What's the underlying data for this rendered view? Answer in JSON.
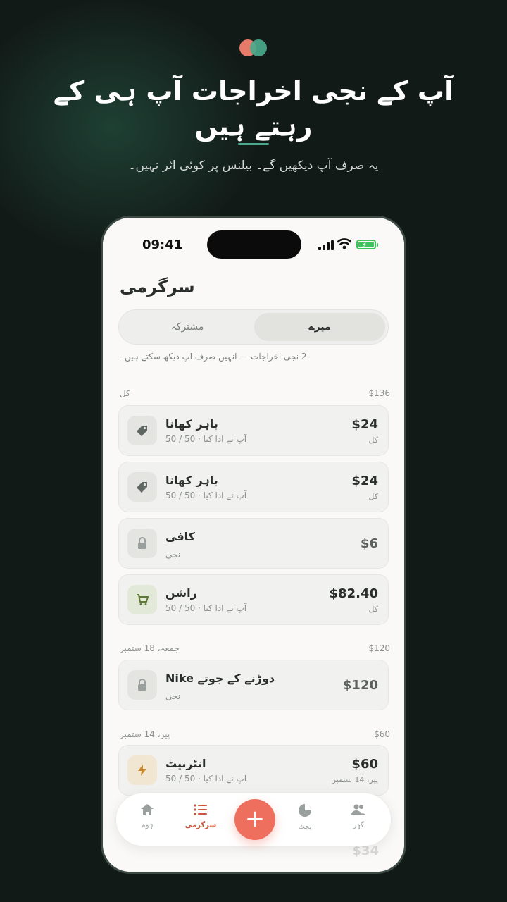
{
  "promo": {
    "headline": "آپ کے نجی اخراجات آپ ہی کے رہتے ہیں",
    "subline": "یہ صرف آپ دیکھیں گے۔ بیلنس پر کوئی اثر نہیں۔"
  },
  "status_bar": {
    "time": "09:41"
  },
  "screen": {
    "title": "سرگرمی",
    "segments": {
      "mine": "میرے",
      "shared": "مشترکہ",
      "active": "mine"
    },
    "note": "2 نجی اخراجات — انہیں صرف آپ دیکھ سکتے ہیں۔"
  },
  "groups": [
    {
      "label": "کل",
      "total": "$136",
      "items": [
        {
          "title": "باہر کھانا",
          "sub": "آپ نے ادا کیا · 50 / 50",
          "amount": "$24",
          "tag": "کل",
          "icon": "tag-icon"
        },
        {
          "title": "باہر کھانا",
          "sub": "آپ نے ادا کیا · 50 / 50",
          "amount": "$24",
          "tag": "کل",
          "icon": "tag-icon"
        },
        {
          "title": "کافی",
          "sub": "نجی",
          "amount": "$6",
          "tag": "",
          "icon": "lock-icon"
        },
        {
          "title": "راشن",
          "sub": "آپ نے ادا کیا · 50 / 50",
          "amount": "$82.40",
          "tag": "کل",
          "icon": "cart-icon"
        }
      ]
    },
    {
      "label": "جمعہ، 18 ستمبر",
      "total": "$120",
      "items": [
        {
          "title": "دوڑنے کے جوتے Nike",
          "sub": "نجی",
          "amount": "$120",
          "tag": "",
          "icon": "lock-icon"
        }
      ]
    },
    {
      "label": "پیر، 14 ستمبر",
      "total": "$60",
      "items": [
        {
          "title": "انٹرنیٹ",
          "sub": "آپ نے ادا کیا · 50 / 50",
          "amount": "$60",
          "tag": "پیر، 14 ستمبر",
          "icon": "bolt-icon"
        }
      ]
    }
  ],
  "ghost_amount": "$34",
  "tabbar": {
    "home": "ہوم",
    "activity": "سرگرمی",
    "add": "+",
    "budget": "بجٹ",
    "household": "گھر"
  },
  "colors": {
    "accent": "#ef6f5e",
    "brand_green": "#4aa98c",
    "active_tab": "#c9553f"
  }
}
